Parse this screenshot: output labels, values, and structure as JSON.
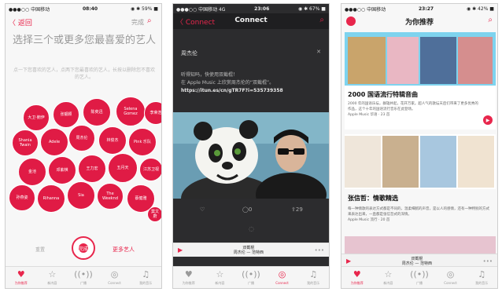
{
  "accent": "#e8264c",
  "phone1": {
    "status": {
      "carrier": "●●●○○ 中国移动",
      "time": "08:40",
      "battery": "◉ ✱ 59% ■"
    },
    "back_label": "〈 返回",
    "skip_label": "完成",
    "title": "选择三个或更多您最喜爱的艺人",
    "subtitle": "点一下您喜欢的艺人，点两下您最喜欢的艺人，长按以删除您不喜欢的艺人。",
    "bubbles": [
      "大卫·鲍伊",
      "张靓颖",
      "陈奕迅",
      "Selena Gomez",
      "李荣浩",
      "Shania Twain",
      "Adele",
      "周杰伦",
      "林俊杰",
      "Pink 乐队",
      "金池",
      "邓紫棋",
      "王力宏",
      "五月天",
      "江苏卫视",
      "孙燕姿",
      "Rihanna",
      "Sia",
      "The Weeknd",
      "蔡健雅",
      "莫文蔚"
    ],
    "reset_label": "重置",
    "center_label": "完成",
    "more_label": "更多艺人"
  },
  "phone2": {
    "status": {
      "carrier": "●●●○○ 中国移动 4G",
      "time": "23:06",
      "battery": "◉ ✱ 67% ■"
    },
    "back_label": "〈 Connect",
    "title": "Connect",
    "artist": "周杰伦",
    "close_label": "✕",
    "post_line1": "听得知吗，快使用双截棍！",
    "post_line2": "在 Apple Music 上欣赏周杰伦的“双截棍”。",
    "post_link": "https://itun.es/cn/gTR7F?i=535739358",
    "likes": "",
    "comments": "0",
    "shares": "29",
    "song": "双截棍",
    "song_artist": "周杰伦 — 范特西"
  },
  "phone3": {
    "status": {
      "carrier": "●●●○○ 中国移动",
      "time": "23:27",
      "battery": "◉ ✱ 42% ■"
    },
    "title": "为你推荐",
    "hero_title": "2000 国语流行特辑音曲",
    "hero_desc": "2000 年的国语乐坛，群雄并起，花开万家。超人气的歌坛天后们带来了更多优秀的作品，这个十年的国语流行音乐在此登场。",
    "hero_meta": "Apple Music 华语 · 23 首",
    "sec2_title": "张信哲：情歌精选",
    "sec2_desc": "每一种情歌的表达方式都是不同的，温柔细腻的声音，是以人的感情，还有一种特别的方式来表达出来，一直都是张信哲式的深情。",
    "sec2_meta": "Apple Music 流行 · 20 首",
    "song": "双截棍",
    "song_artist": "周杰伦 — 范特西"
  },
  "tabs": [
    {
      "icon": "heart-icon",
      "glyph": "♥",
      "label": "为你推荐"
    },
    {
      "icon": "star-icon",
      "glyph": "☆",
      "label": "新内容"
    },
    {
      "icon": "radio-icon",
      "glyph": "((•))",
      "label": "广播"
    },
    {
      "icon": "connect-icon",
      "glyph": "◎",
      "label": "Connect"
    },
    {
      "icon": "music-note-icon",
      "glyph": "♫",
      "label": "我的音乐"
    }
  ]
}
